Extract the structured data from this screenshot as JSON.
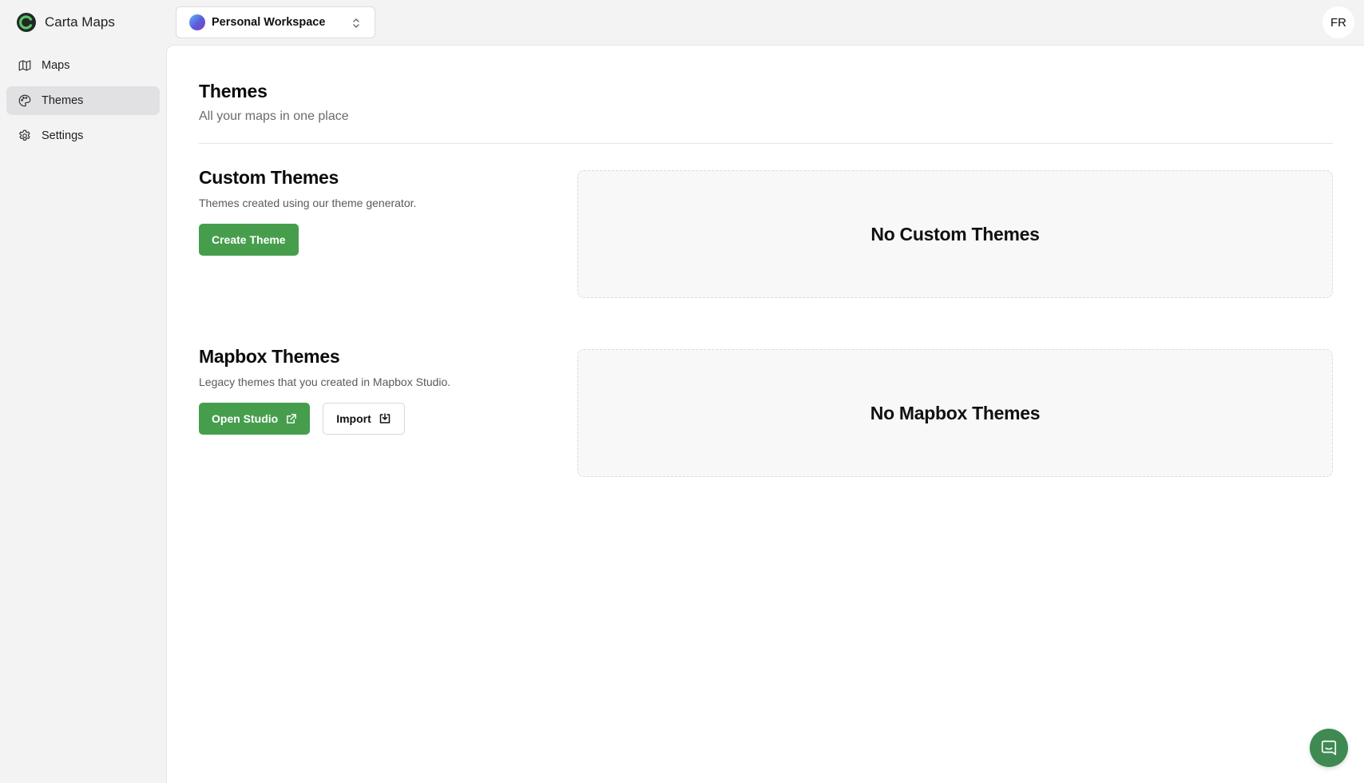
{
  "app": {
    "name": "Carta Maps"
  },
  "sidebar": {
    "items": [
      {
        "label": "Maps",
        "icon": "map-icon",
        "active": false
      },
      {
        "label": "Themes",
        "icon": "palette-icon",
        "active": true
      },
      {
        "label": "Settings",
        "icon": "gear-icon",
        "active": false
      }
    ]
  },
  "header": {
    "workspace": {
      "name": "Personal Workspace",
      "icon": "chevron-up-down-icon"
    },
    "user_initials": "FR"
  },
  "page": {
    "title": "Themes",
    "subtitle": "All your maps in one place"
  },
  "sections": {
    "custom": {
      "title": "Custom Themes",
      "description": "Themes created using our theme generator.",
      "create_label": "Create Theme",
      "empty_label": "No Custom Themes"
    },
    "mapbox": {
      "title": "Mapbox Themes",
      "description": "Legacy themes that you created in Mapbox Studio.",
      "open_label": "Open Studio",
      "import_label": "Import",
      "empty_label": "No Mapbox Themes"
    }
  },
  "colors": {
    "accent": "#469e4d",
    "help_button": "#3f8a53",
    "sidebar_bg": "#f3f3f4",
    "active_nav": "#e1e1e3"
  }
}
